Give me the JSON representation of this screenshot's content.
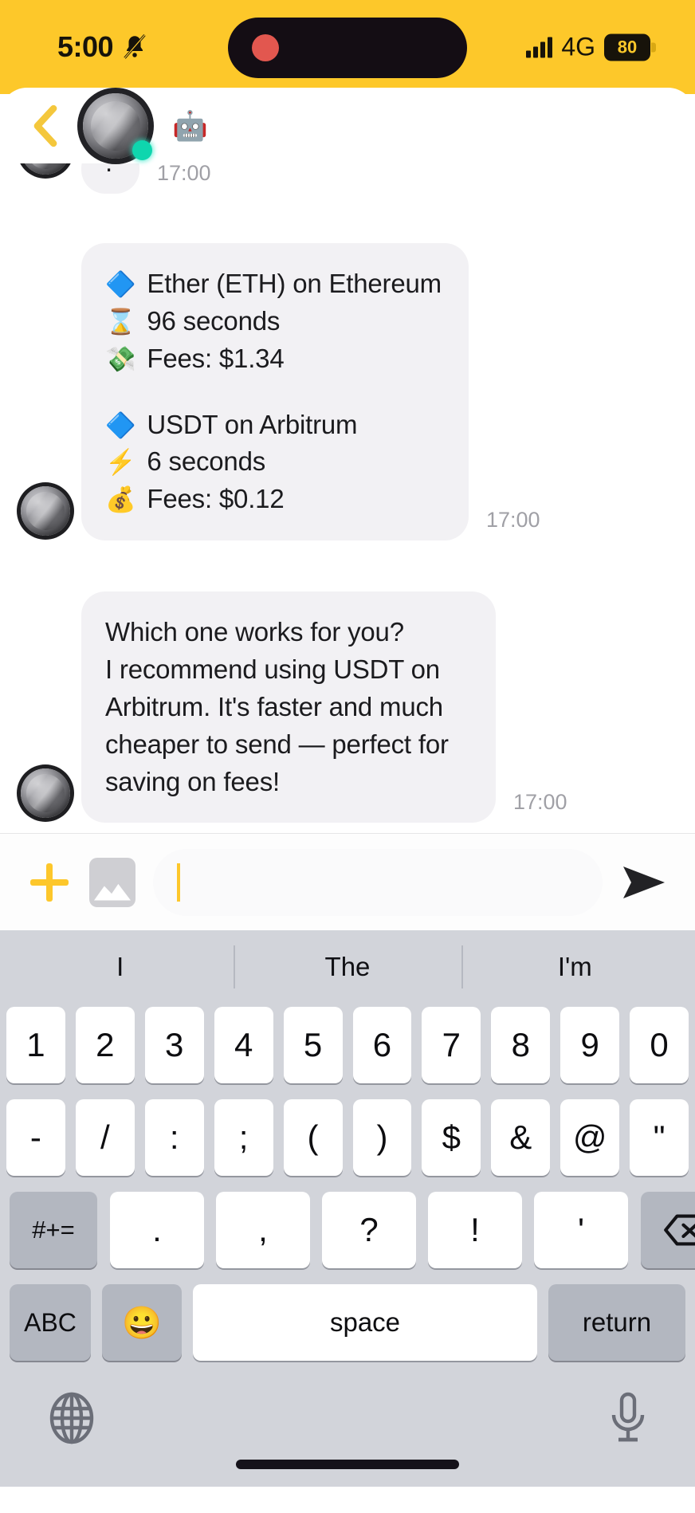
{
  "status_bar": {
    "time": "5:00",
    "mute_icon": "bell-slash-icon",
    "network": "4G",
    "battery_level": "80",
    "signal_icon": "signal-bars-icon",
    "island_recording_icon": "recording-dot-icon",
    "background_color": "#fdc82a"
  },
  "header": {
    "back_icon": "chevron-left-icon",
    "avatar_icon": "contact-avatar",
    "online_status_icon": "online-dot-icon",
    "contact_name": "🤖"
  },
  "chat": {
    "messages": [
      {
        "id": "msg-cropped",
        "type": "cropped",
        "text": ".",
        "time": "17:00"
      },
      {
        "id": "msg-options",
        "type": "list",
        "time": "17:00",
        "lines": [
          {
            "emoji": "🔷",
            "text": "Ether (ETH) on Ethereum"
          },
          {
            "emoji": "⌛",
            "text": "96 seconds"
          },
          {
            "emoji": "💸",
            "text": "Fees: $1.34"
          },
          {
            "emoji": "",
            "text": ""
          },
          {
            "emoji": "🔷",
            "text": "USDT on Arbitrum"
          },
          {
            "emoji": "⚡",
            "text": "6 seconds"
          },
          {
            "emoji": "💰",
            "text": "Fees: $0.12"
          }
        ]
      },
      {
        "id": "msg-recommendation",
        "type": "text",
        "time": "17:00",
        "text": "Which one works for you?\nI recommend using USDT on Arbitrum. It's faster and much cheaper to send — perfect for saving on fees!"
      }
    ]
  },
  "input_bar": {
    "add_icon": "plus-icon",
    "photo_icon": "image-icon",
    "field_value": "",
    "field_placeholder": "",
    "send_icon": "send-arrow-icon"
  },
  "keyboard": {
    "suggestions": [
      "I",
      "The",
      "I'm"
    ],
    "row1": [
      "1",
      "2",
      "3",
      "4",
      "5",
      "6",
      "7",
      "8",
      "9",
      "0"
    ],
    "row2": [
      "-",
      "/",
      ":",
      ";",
      "(",
      ")",
      "$",
      "&",
      "@",
      "\""
    ],
    "row3": {
      "symbols_key": "#+=",
      "keys": [
        ".",
        ",",
        "?",
        "!",
        "'"
      ],
      "backspace_icon": "backspace-icon"
    },
    "row4": {
      "abc_key": "ABC",
      "emoji_key": "😀",
      "space_key": "space",
      "return_key": "return"
    },
    "globe_icon": "globe-icon",
    "mic_icon": "microphone-icon"
  }
}
